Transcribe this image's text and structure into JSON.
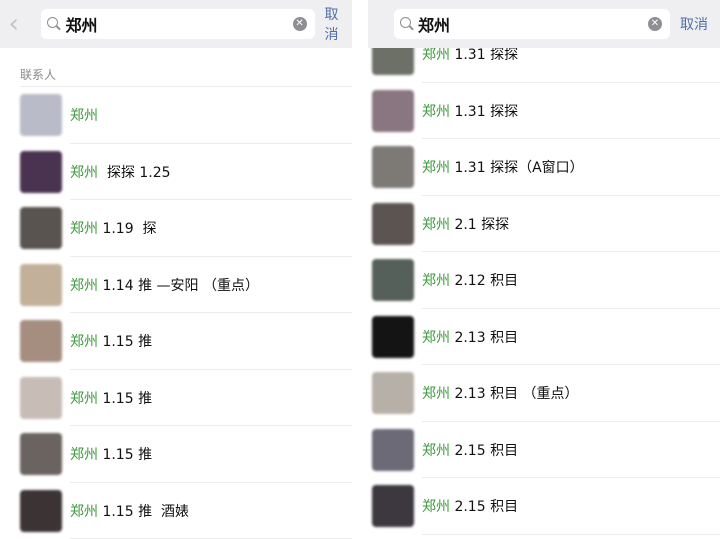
{
  "search": {
    "query": "郑州",
    "cancel_label": "取消"
  },
  "left": {
    "section_label": "联系人",
    "contacts": [
      {
        "highlight": "郑州",
        "rest": "",
        "avatar_color": "#b9bcc8"
      },
      {
        "highlight": "郑州",
        "rest": "  探探 1.25",
        "avatar_color": "#4a3350"
      },
      {
        "highlight": "郑州",
        "rest": " 1.19  探",
        "avatar_color": "#5a5450"
      },
      {
        "highlight": "郑州",
        "rest": " 1.14 推 —安阳 （重点）",
        "avatar_color": "#c2b09a"
      },
      {
        "highlight": "郑州",
        "rest": " 1.15 推",
        "avatar_color": "#a58e80"
      },
      {
        "highlight": "郑州",
        "rest": " 1.15 推",
        "avatar_color": "#c7bcb6"
      },
      {
        "highlight": "郑州",
        "rest": " 1.15 推",
        "avatar_color": "#6a6360"
      },
      {
        "highlight": "郑州",
        "rest": " 1.15 推  酒婊",
        "avatar_color": "#3c3434"
      }
    ]
  },
  "right": {
    "contacts": [
      {
        "highlight": "郑州",
        "rest": " 1.31 探探",
        "avatar_color": "#6d7066"
      },
      {
        "highlight": "郑州",
        "rest": " 1.31 探探",
        "avatar_color": "#8a7680"
      },
      {
        "highlight": "郑州",
        "rest": " 1.31 探探（A窗口）",
        "avatar_color": "#7d7a76"
      },
      {
        "highlight": "郑州",
        "rest": " 2.1 探探",
        "avatar_color": "#5c5450"
      },
      {
        "highlight": "郑州",
        "rest": " 2.12 积目",
        "avatar_color": "#55605a"
      },
      {
        "highlight": "郑州",
        "rest": " 2.13 积目",
        "avatar_color": "#141414"
      },
      {
        "highlight": "郑州",
        "rest": " 2.13 积目 （重点）",
        "avatar_color": "#b7b0a8"
      },
      {
        "highlight": "郑州",
        "rest": " 2.15 积目",
        "avatar_color": "#6d6a78"
      },
      {
        "highlight": "郑州",
        "rest": " 2.15 积目",
        "avatar_color": "#3d3840"
      }
    ]
  }
}
